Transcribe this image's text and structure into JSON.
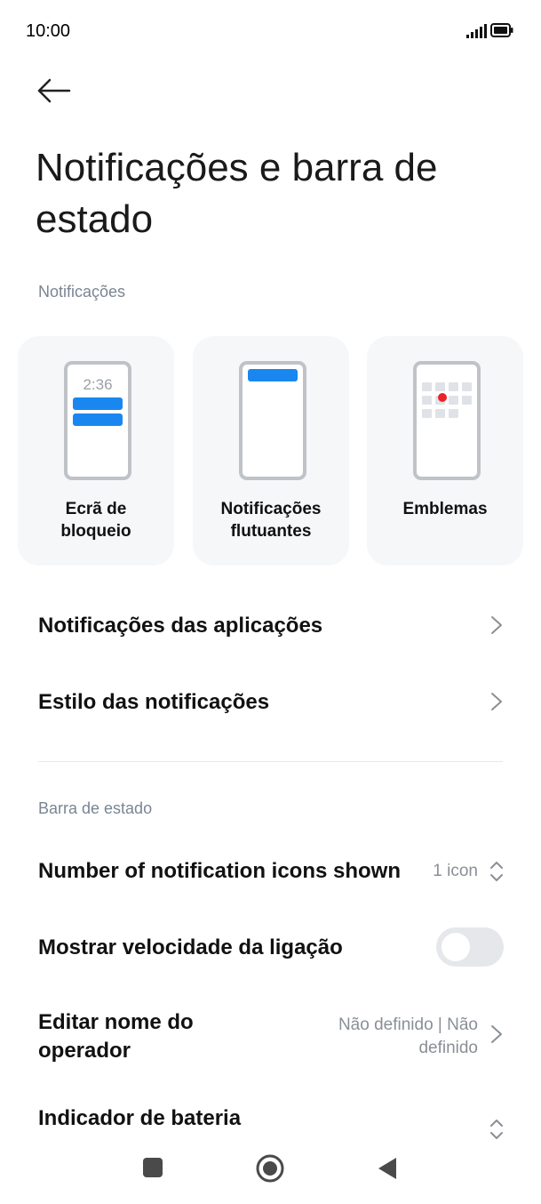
{
  "status_bar": {
    "time": "10:00"
  },
  "page": {
    "title": "Notificações e barra de estado"
  },
  "sections": {
    "notifications_label": "Notificações",
    "status_bar_label": "Barra de estado"
  },
  "cards": [
    {
      "label_line1": "Ecrã de",
      "label_line2": "bloqueio",
      "clock": "2:36"
    },
    {
      "label_line1": "Notificações",
      "label_line2": "flutuantes"
    },
    {
      "label_line1": "Emblemas",
      "label_line2": ""
    }
  ],
  "rows": {
    "app_notifications": "Notificações das aplicações",
    "notification_style": "Estilo das notificações",
    "icons_shown": {
      "label": "Number of notification icons shown",
      "value": "1 icon"
    },
    "connection_speed": {
      "label": "Mostrar velocidade da ligação",
      "enabled": false
    },
    "carrier_name": {
      "label_line1": "Editar nome do",
      "label_line2": "operador",
      "value_line1": "Não definido | Não",
      "value_line2": "definido"
    },
    "battery_indicator": {
      "label": "Indicador de bateria"
    }
  },
  "colors": {
    "accent": "#1a87f0",
    "badge_dot": "#e8232a"
  }
}
